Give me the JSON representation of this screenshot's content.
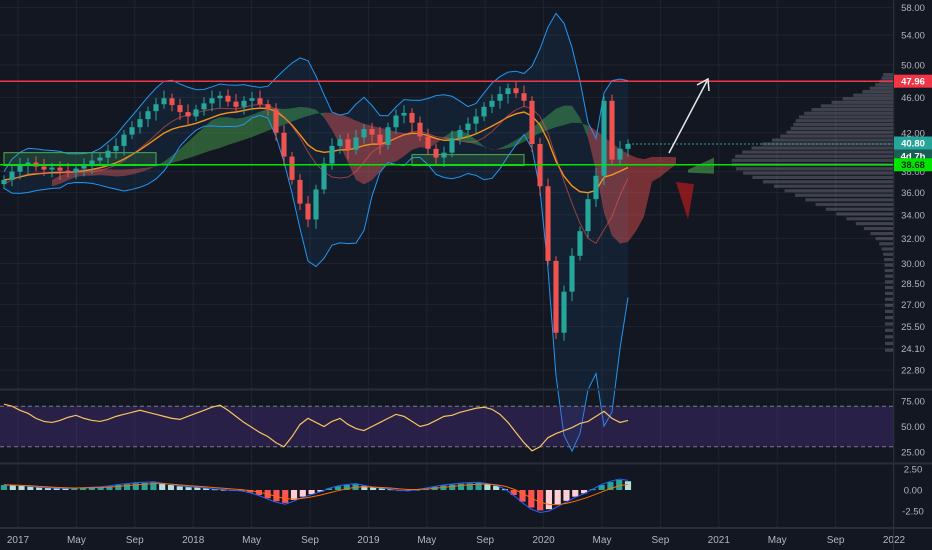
{
  "chart_data": [
    {
      "type": "candlestick",
      "panel": "price",
      "y_ticks": [
        "58.00",
        "54.00",
        "50.00",
        "46.00",
        "42.00",
        "38.00",
        "36.00",
        "34.00",
        "32.00",
        "30.00",
        "28.50",
        "27.00",
        "25.50",
        "24.10",
        "22.80"
      ],
      "ylim": [
        22.0,
        58.5
      ],
      "log_scale": true,
      "price_labels": {
        "resistance": "47.96",
        "last_price": "40.80",
        "countdown": "4d 7h",
        "support": "38.68"
      },
      "horizontal_lines": [
        {
          "name": "resistance",
          "value": 47.96,
          "color": "#f23645"
        },
        {
          "name": "support",
          "value": 38.68,
          "color": "#00e600"
        }
      ],
      "close_series": [
        37.2,
        38.0,
        38.6,
        38.9,
        38.5,
        38.2,
        38.4,
        38.1,
        37.9,
        38.3,
        38.7,
        39.1,
        39.4,
        40.1,
        40.6,
        41.8,
        42.6,
        43.5,
        44.4,
        45.2,
        45.9,
        45.1,
        44.3,
        43.8,
        44.6,
        45.3,
        45.9,
        46.2,
        45.5,
        44.9,
        45.6,
        45.9,
        45.2,
        44.6,
        42.0,
        39.5,
        37.2,
        35.0,
        33.6,
        36.3,
        38.8,
        40.6,
        41.3,
        40.2,
        41.5,
        42.4,
        41.8,
        40.7,
        42.6,
        43.9,
        44.2,
        43.1,
        41.6,
        40.3,
        39.4,
        39.9,
        41.4,
        42.3,
        43.0,
        43.8,
        44.9,
        45.6,
        46.4,
        47.1,
        46.5,
        45.6,
        40.8,
        36.6,
        30.2,
        25.1,
        27.9,
        30.6,
        32.6,
        35.4,
        37.6,
        45.6,
        39.2,
        40.3,
        40.8
      ],
      "series": [
        {
          "name": "",
          "color": "#f7931a"
        },
        {
          "name": "",
          "color": "#2962ff"
        }
      ],
      "visible_range": [
        37.6,
        47.96
      ],
      "volume_profile": true
    },
    {
      "type": "line",
      "panel": "oscillator",
      "y_ticks": [
        "75.00",
        "50.00",
        "25.00"
      ],
      "ylim": [
        15,
        85
      ],
      "band": [
        30,
        70
      ],
      "values": [
        72,
        70,
        66,
        63,
        58,
        55,
        54,
        56,
        59,
        61,
        58,
        56,
        55,
        57,
        60,
        62,
        64,
        66,
        64,
        62,
        60,
        58,
        57,
        60,
        63,
        66,
        69,
        71,
        66,
        60,
        54,
        49,
        44,
        40,
        34,
        30,
        40,
        52,
        58,
        54,
        50,
        55,
        58,
        52,
        48,
        46,
        50,
        54,
        58,
        62,
        60,
        55,
        50,
        52,
        56,
        60,
        61,
        64,
        66,
        68,
        69,
        67,
        62,
        54,
        44,
        34,
        26,
        30,
        39,
        43,
        46,
        49,
        53,
        55,
        60,
        65,
        58,
        54,
        56
      ]
    },
    {
      "type": "bar",
      "panel": "momentum",
      "y_ticks": [
        "2.50",
        "0.00",
        "-2.50"
      ],
      "ylim": [
        -3.6,
        3.0
      ],
      "values": [
        0.6,
        0.55,
        0.5,
        0.4,
        0.3,
        0.25,
        0.2,
        0.18,
        0.2,
        0.25,
        0.3,
        0.35,
        0.45,
        0.6,
        0.7,
        0.8,
        0.85,
        0.9,
        0.75,
        0.6,
        0.45,
        0.35,
        0.3,
        0.2,
        0.1,
        0.05,
        -0.05,
        -0.1,
        -0.3,
        -0.6,
        -1.0,
        -1.35,
        -1.55,
        -1.2,
        -0.8,
        -0.5,
        -0.2,
        0.2,
        0.45,
        0.6,
        0.7,
        0.5,
        0.3,
        0.2,
        0.1,
        -0.05,
        -0.1,
        0.05,
        0.2,
        0.4,
        0.55,
        0.65,
        0.75,
        0.8,
        0.85,
        0.7,
        0.5,
        0.1,
        -0.6,
        -1.4,
        -2.1,
        -2.45,
        -2.3,
        -1.8,
        -1.3,
        -0.8,
        -0.4,
        0.1,
        0.6,
        0.95,
        1.2,
        1.05
      ]
    }
  ],
  "x_axis": {
    "labels": [
      "2017",
      "May",
      "Sep",
      "2018",
      "May",
      "Sep",
      "2019",
      "May",
      "Sep",
      "2020",
      "May",
      "Sep",
      "2021",
      "May",
      "Sep",
      "2022"
    ]
  },
  "colors": {
    "background": "#131722",
    "up": "#26a69a",
    "down": "#ef5350",
    "grid": "#1f2430",
    "axis_text": "#b2b5be"
  }
}
